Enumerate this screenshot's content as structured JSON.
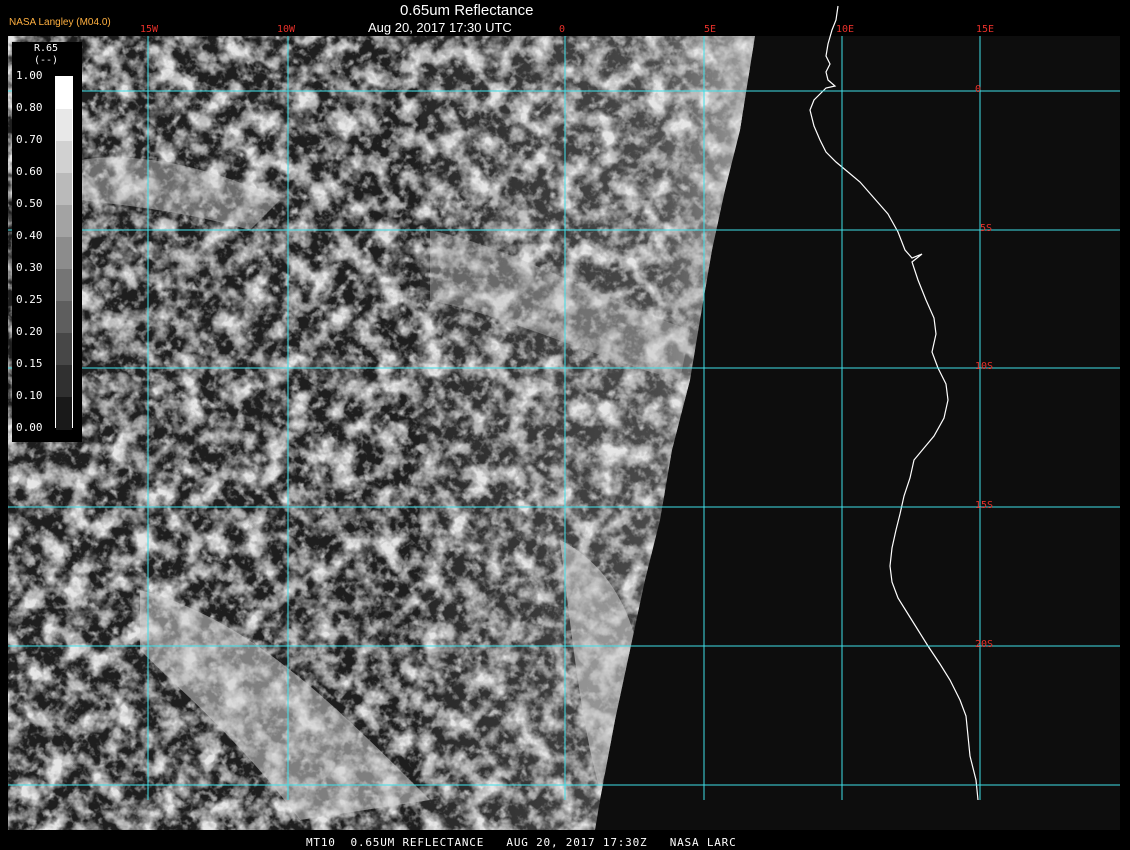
{
  "header": {
    "agency": "NASA Langley (M04.0)",
    "title": "0.65um Reflectance",
    "subtitle": "Aug 20, 2017 17:30 UTC"
  },
  "footer": {
    "text": "MT10  0.65UM REFLECTANCE   AUG 20, 2017 17:30Z   NASA LARC"
  },
  "legend": {
    "title": "R.65",
    "units": "(--)",
    "ticks": [
      "1.00",
      "0.80",
      "0.70",
      "0.60",
      "0.50",
      "0.40",
      "0.30",
      "0.25",
      "0.20",
      "0.15",
      "0.10",
      "0.00"
    ]
  },
  "grid": {
    "longitude_labels": [
      "15W",
      "10W",
      "0",
      "5E",
      "10E",
      "15E"
    ],
    "latitude_labels": [
      "0",
      "5S",
      "10S",
      "15S",
      "20S"
    ]
  },
  "colors": {
    "grid_line": "#40e0e8",
    "grid_label": "#e8302a",
    "coastline": "#ffffff",
    "agency_text": "#ffb040"
  }
}
